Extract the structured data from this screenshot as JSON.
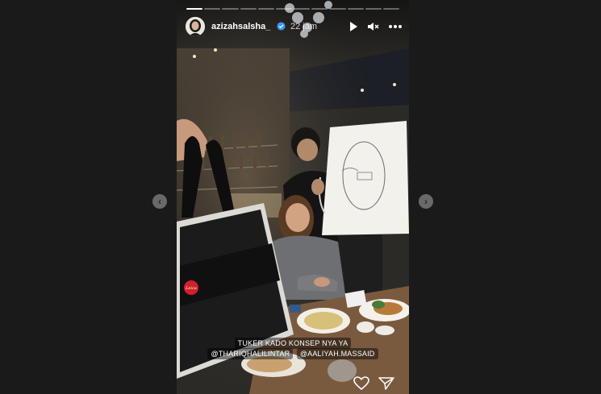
{
  "story": {
    "username": "azizahsalsha_",
    "time": "22 jam",
    "progress": {
      "segments": 12,
      "current": 1
    },
    "caption": {
      "line1": "TUKER KADO KONSEP NYA YA",
      "mention1": "@THARIQHALILINTAR",
      "mention2": "@AALIYAH.MASSAID"
    }
  },
  "icons": {
    "prev": "chevron-left-icon",
    "next": "chevron-right-icon",
    "play": "play-icon",
    "mute": "speaker-muted-icon",
    "more": "more-horizontal-icon",
    "verified": "verified-badge-icon",
    "like": "heart-icon",
    "share": "send-icon"
  },
  "colors": {
    "background": "#1a1a1a",
    "verified": "#3897f0",
    "text": "#ffffff"
  }
}
